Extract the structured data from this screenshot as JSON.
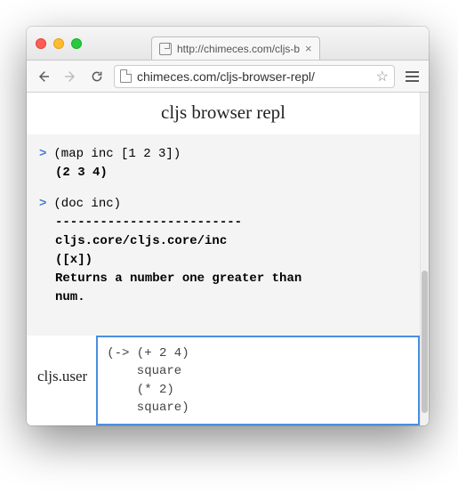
{
  "tab": {
    "title": "http://chimeces.com/cljs-b"
  },
  "omnibox": {
    "url": "chimeces.com/cljs-browser-repl/"
  },
  "page": {
    "title": "cljs browser repl"
  },
  "history": [
    {
      "input": "(map inc [1 2 3])",
      "result": "(2 3 4)"
    },
    {
      "input": "(doc inc)",
      "doc": {
        "sep": "-------------------------",
        "name": "cljs.core/cljs.core/inc",
        "args": "([x])",
        "desc_line1": "  Returns a number one greater than",
        "desc_line2": "num."
      }
    }
  ],
  "input": {
    "namespace": "cljs.user",
    "code": "(-> (+ 2 4)\n    square\n    (* 2)\n    square)"
  }
}
